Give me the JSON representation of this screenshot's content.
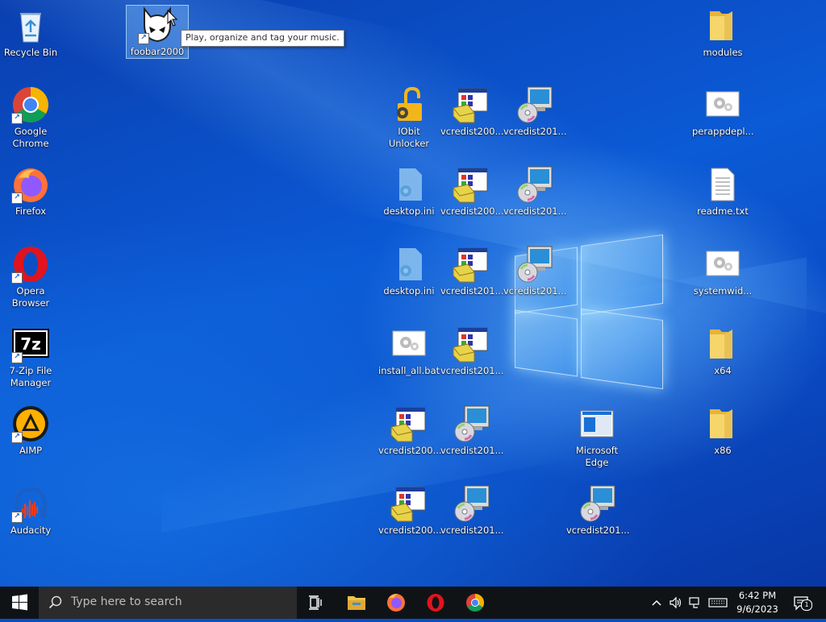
{
  "desktop": {
    "icons": [
      {
        "key": "recycle",
        "label": "Recycle Bin"
      },
      {
        "key": "foobar",
        "label": "foobar2000"
      },
      {
        "key": "modules",
        "label": "modules"
      },
      {
        "key": "chrome",
        "label": "Google Chrome"
      },
      {
        "key": "iobit",
        "label": "IObit Unlocker"
      },
      {
        "key": "vc1",
        "label": "vcredist200..."
      },
      {
        "key": "vc2",
        "label": "vcredist201..."
      },
      {
        "key": "perapp",
        "label": "perappdepl..."
      },
      {
        "key": "firefox",
        "label": "Firefox"
      },
      {
        "key": "desktopini1",
        "label": "desktop.ini"
      },
      {
        "key": "vc3",
        "label": "vcredist200..."
      },
      {
        "key": "vc4",
        "label": "vcredist201..."
      },
      {
        "key": "readme",
        "label": "readme.txt"
      },
      {
        "key": "opera",
        "label": "Opera Browser"
      },
      {
        "key": "desktopini2",
        "label": "desktop.ini"
      },
      {
        "key": "vc5",
        "label": "vcredist201..."
      },
      {
        "key": "vc6",
        "label": "vcredist201..."
      },
      {
        "key": "systemwid",
        "label": "systemwid..."
      },
      {
        "key": "7zip",
        "label": "7-Zip File Manager"
      },
      {
        "key": "installall",
        "label": "install_all.bat"
      },
      {
        "key": "vc7",
        "label": "vcredist201..."
      },
      {
        "key": "x64",
        "label": "x64"
      },
      {
        "key": "aimp",
        "label": "AIMP"
      },
      {
        "key": "vc8",
        "label": "vcredist200..."
      },
      {
        "key": "vc9",
        "label": "vcredist201..."
      },
      {
        "key": "edge",
        "label": "Microsoft Edge"
      },
      {
        "key": "x86",
        "label": "x86"
      },
      {
        "key": "audacity",
        "label": "Audacity"
      },
      {
        "key": "vc10",
        "label": "vcredist200..."
      },
      {
        "key": "vc11",
        "label": "vcredist201..."
      },
      {
        "key": "vc12",
        "label": "vcredist201..."
      }
    ],
    "tooltip": "Play, organize and tag your music."
  },
  "taskbar": {
    "search_placeholder": "Type here to search",
    "pinned": [
      "task-view",
      "file-explorer",
      "firefox",
      "opera",
      "chrome"
    ],
    "time": "6:42 PM",
    "date": "9/6/2023",
    "notification_count": "1"
  },
  "colors": {
    "taskbar": "#101316",
    "accent": "#0b5ad6"
  }
}
